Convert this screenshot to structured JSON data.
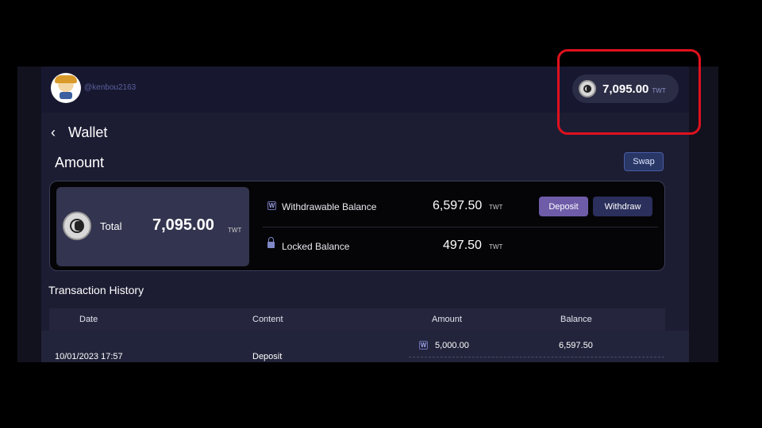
{
  "header": {
    "username": "@kenbou2163",
    "balance_amount": "7,095.00",
    "balance_unit": "TWT",
    "coin_icon": "twt-coin-icon"
  },
  "page": {
    "back_icon": "chevron-left-icon",
    "back_glyph": "‹",
    "title": "Wallet",
    "section_title": "Amount",
    "swap_label": "Swap"
  },
  "balance_card": {
    "total_label": "Total",
    "total_amount": "7,095.00",
    "total_unit": "TWT",
    "withdrawable_icon_glyph": "W",
    "withdrawable_label": "Withdrawable Balance",
    "withdrawable_amount": "6,597.50",
    "withdrawable_unit": "TWT",
    "deposit_label": "Deposit",
    "withdraw_label": "Withdraw",
    "locked_label": "Locked Balance",
    "locked_amount": "497.50",
    "locked_unit": "TWT"
  },
  "transactions": {
    "title": "Transaction History",
    "columns": [
      "Date",
      "Content",
      "Amount",
      "Balance"
    ],
    "rows": [
      {
        "date": "10/01/2023 17:57",
        "content": "Deposit",
        "amount_icon_glyph": "W",
        "amount": "5,000.00",
        "balance": "6,597.50"
      }
    ]
  },
  "colors": {
    "background": "#1c1d33",
    "accent_purple": "#6e5ca8",
    "highlight_red": "#e0111e"
  }
}
